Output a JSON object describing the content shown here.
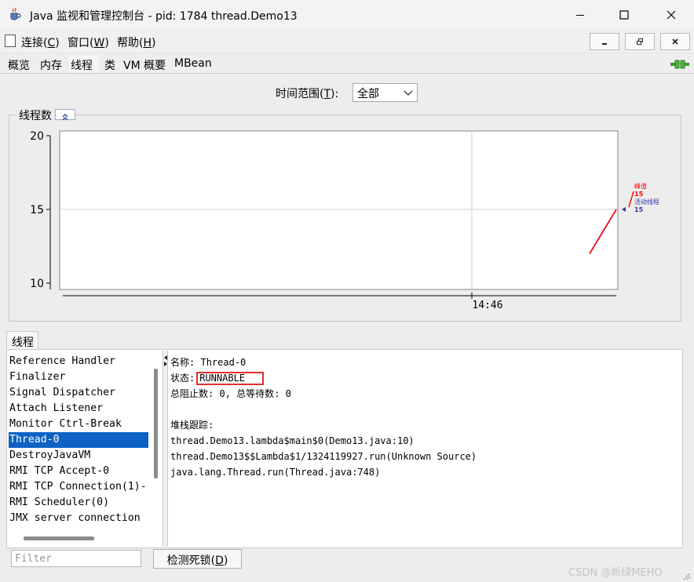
{
  "window": {
    "title": "Java 监视和管理控制台 - pid: 1784 thread.Demo13"
  },
  "menu": {
    "connect": {
      "before": "连接(",
      "key": "C",
      "after": ")"
    },
    "window": {
      "before": "窗口(",
      "key": "W",
      "after": ")"
    },
    "help": {
      "before": "帮助(",
      "key": "H",
      "after": ")"
    }
  },
  "tabs": {
    "overview": "概览",
    "memory": "内存",
    "threads": "线程",
    "classes": "类",
    "vm_summary": "VM 概要",
    "mbean": "MBean",
    "selected": "线程"
  },
  "time_range": {
    "label_before": "时间范围(",
    "label_key": "T",
    "label_after": "):",
    "value": "全部"
  },
  "chart_panel": {
    "title": "线程数"
  },
  "chart_data": {
    "type": "line",
    "title": "线程数",
    "xlabel": "",
    "ylabel": "",
    "ylim": [
      10,
      20
    ],
    "y_ticks": [
      20,
      15,
      10
    ],
    "x_tick_labels": [
      "14:46"
    ],
    "grid": true,
    "legend": "right",
    "series": [
      {
        "name": "峰值",
        "color": "#ff0000",
        "values": [
          12,
          15
        ],
        "label_value": "15"
      },
      {
        "name": "活动线程",
        "color": "#3333aa",
        "values": [
          12,
          15
        ],
        "label_value": "15"
      }
    ]
  },
  "threads_panel": {
    "tab_label": "线程",
    "list": [
      "Reference Handler",
      "Finalizer",
      "Signal Dispatcher",
      "Attach Listener",
      "Monitor Ctrl-Break",
      "Thread-0",
      "DestroyJavaVM",
      "RMI TCP Accept-0",
      "RMI TCP Connection(1)-",
      "RMI Scheduler(0)",
      "JMX server connection"
    ],
    "selected": "Thread-0",
    "filter_placeholder": "Filter",
    "deadlock_button": {
      "before": "检测死锁(",
      "key": "D",
      "after": ")"
    }
  },
  "thread_detail": {
    "name_label": "名称:",
    "name_value": "Thread-0",
    "state_label": "状态:",
    "state_value": "RUNNABLE",
    "counts": "总阻止数: 0, 总等待数: 0",
    "stack_label": "堆栈跟踪:",
    "stack": [
      "thread.Demo13.lambda$main$0(Demo13.java:10)",
      "thread.Demo13$$Lambda$1/1324119927.run(Unknown Source)",
      "java.lang.Thread.run(Thread.java:748)"
    ]
  },
  "watermark": "CSDN @新绿MEHO",
  "colors": {
    "selection": "#0e62c4",
    "peak_line": "#ff0000",
    "live_line": "#3333aa",
    "highlight_box": "#e03030"
  }
}
